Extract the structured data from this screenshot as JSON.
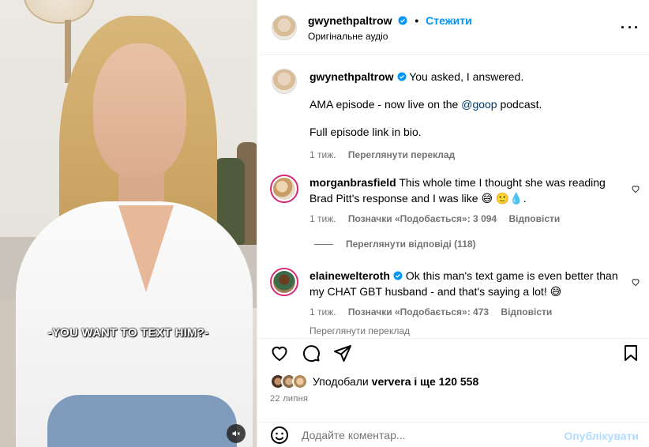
{
  "media": {
    "subtitle": "-YOU WANT TO TEXT HIM?-"
  },
  "header": {
    "username": "gwynethpaltrow",
    "follow_label": "Стежити",
    "audio_label": "Оригінальне аудіо"
  },
  "caption": {
    "username": "gwynethpaltrow",
    "line1": "You asked, I answered.",
    "line2_before": "AMA episode - now live on the ",
    "line2_mention": "@goop",
    "line2_after": " podcast.",
    "line3": "Full episode link in bio.",
    "time": "1 тиж.",
    "translate_label": "Переглянути переклад"
  },
  "comments": [
    {
      "username": "morganbrasfield",
      "text": "This whole time I thought she was reading Brad Pitt's response and I was like 😅 🙂💧.",
      "time": "1 тиж.",
      "likes_label": "Позначки «Подобається»: 3 094",
      "reply_label": "Відповісти",
      "view_replies_label": "Переглянути відповіді (118)"
    },
    {
      "username": "elainewelteroth",
      "text": "Ok this man's text game is even better than my CHAT GBT husband - and that's saying a lot! 😅",
      "time": "1 тиж.",
      "likes_label": "Позначки «Подобається»: 473",
      "reply_label": "Відповісти",
      "translate_label": "Переглянути переклад"
    }
  ],
  "likes": {
    "text_prefix": "Уподобали ",
    "user": "ververa",
    "text_suffix": " і ще 120 558"
  },
  "date": "22 липня",
  "composer": {
    "placeholder": "Додайте коментар...",
    "post_label": "Опублікувати"
  },
  "colors": {
    "link_blue": "#0095f6",
    "post_disabled": "#b3dbff",
    "secondary_text": "#737373",
    "verified": "#0095f6"
  },
  "icons": [
    "more-icon",
    "verified-icon",
    "heart-icon",
    "comment-icon",
    "share-icon",
    "save-icon",
    "emoji-icon",
    "mute-icon"
  ]
}
